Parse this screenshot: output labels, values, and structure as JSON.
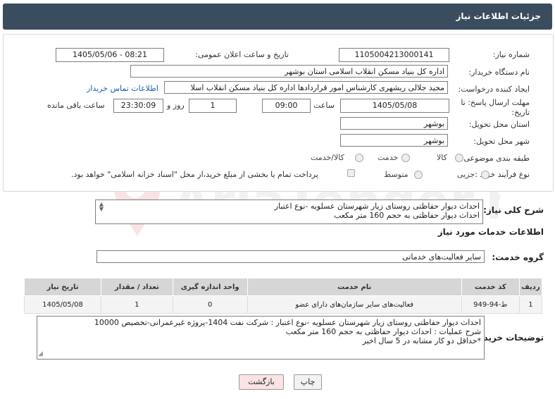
{
  "header": {
    "title": "جزئیات اطلاعات نیاز"
  },
  "form": {
    "need_number": {
      "label": "شماره نیاز:",
      "value": "1105004213000141"
    },
    "announce": {
      "label": "تاریخ و ساعت اعلان عمومی:",
      "value": "1405/05/06 - 08:21"
    },
    "buyer": {
      "label": "نام دستگاه خریدار:",
      "value": "اداره کل بنیاد مسکن انقلاب اسلامی استان بوشهر"
    },
    "creator": {
      "label": "ایجاد کننده درخواست:",
      "value": "مجید جلالی ریشهری کارشناس امور قراردادها اداره کل بنیاد مسکن انقلاب اسلا",
      "link": "اطلاعات تماس خریدار"
    },
    "deadline": {
      "label": "مهلت ارسال پاسخ: تا تاریخ:",
      "date": "1405/05/08",
      "time_label": "ساعت",
      "time": "09:00",
      "days": "1",
      "days_label": "روز و",
      "remaining": "23:30:09",
      "remaining_label": "ساعت باقی مانده"
    },
    "province": {
      "label": "استان محل تحویل:",
      "value": "بوشهر"
    },
    "city": {
      "label": "شهر محل تحویل:",
      "value": "بوشهر"
    },
    "category": {
      "label": "طبقه بندی موضوعی:",
      "options": [
        "کالا",
        "خدمت",
        "کالا/خدمت"
      ]
    },
    "process": {
      "label": "نوع فرآیند خرید :",
      "options": [
        "جزیی",
        "متوسط"
      ],
      "checkbox_text": "پرداخت تمام یا بخشی از مبلغ خرید،از محل \"اسناد خزانه اسلامی\" خواهد بود."
    }
  },
  "summary": {
    "label": "شرح کلی نیاز:",
    "lines": [
      "احداث دیوار حفاظتی روستای زیار شهرستان عسلویه -نوع اعتبار",
      "احداث دیوار حفاظتی به حجم 160 متر مکعب"
    ]
  },
  "services": {
    "title": "اطلاعات خدمات مورد نیاز",
    "group_label": "گروه خدمت:",
    "group_value": "سایر فعالیت‌های خدماتی",
    "columns": [
      "ردیف",
      "کد خدمت",
      "نام خدمت",
      "واحد اندازه گیری",
      "تعداد / مقدار",
      "تاریخ نیاز"
    ],
    "rows": [
      {
        "row": "1",
        "code": "ط-94-949",
        "name": "فعالیت‌های سایر سازمان‌های دارای عضو",
        "unit": "0",
        "qty": "1",
        "date": "1405/05/08"
      }
    ]
  },
  "buyer_notes": {
    "label": "توضیحات خریدار:",
    "lines": [
      "احداث دیوار حفاظتی روستای زیار شهرستان عسلویه -نوع اعتبار : شرکت نفت 1404-پروژه غیرعمرانی-تخصیص 10000",
      "شرح عملیات : احداث دیوار حفاظتی به حجم 160 متر مکعب",
      "*حداقل دو کار مشابه در 5 سال اخیر"
    ]
  },
  "buttons": {
    "print": "چاپ",
    "back": "بازگشت"
  },
  "watermark": "AriaTender.net",
  "colors": {
    "header_bg": "#3a4d5e",
    "link": "#1a5fb4",
    "back_bg": "#fbe3e3"
  }
}
